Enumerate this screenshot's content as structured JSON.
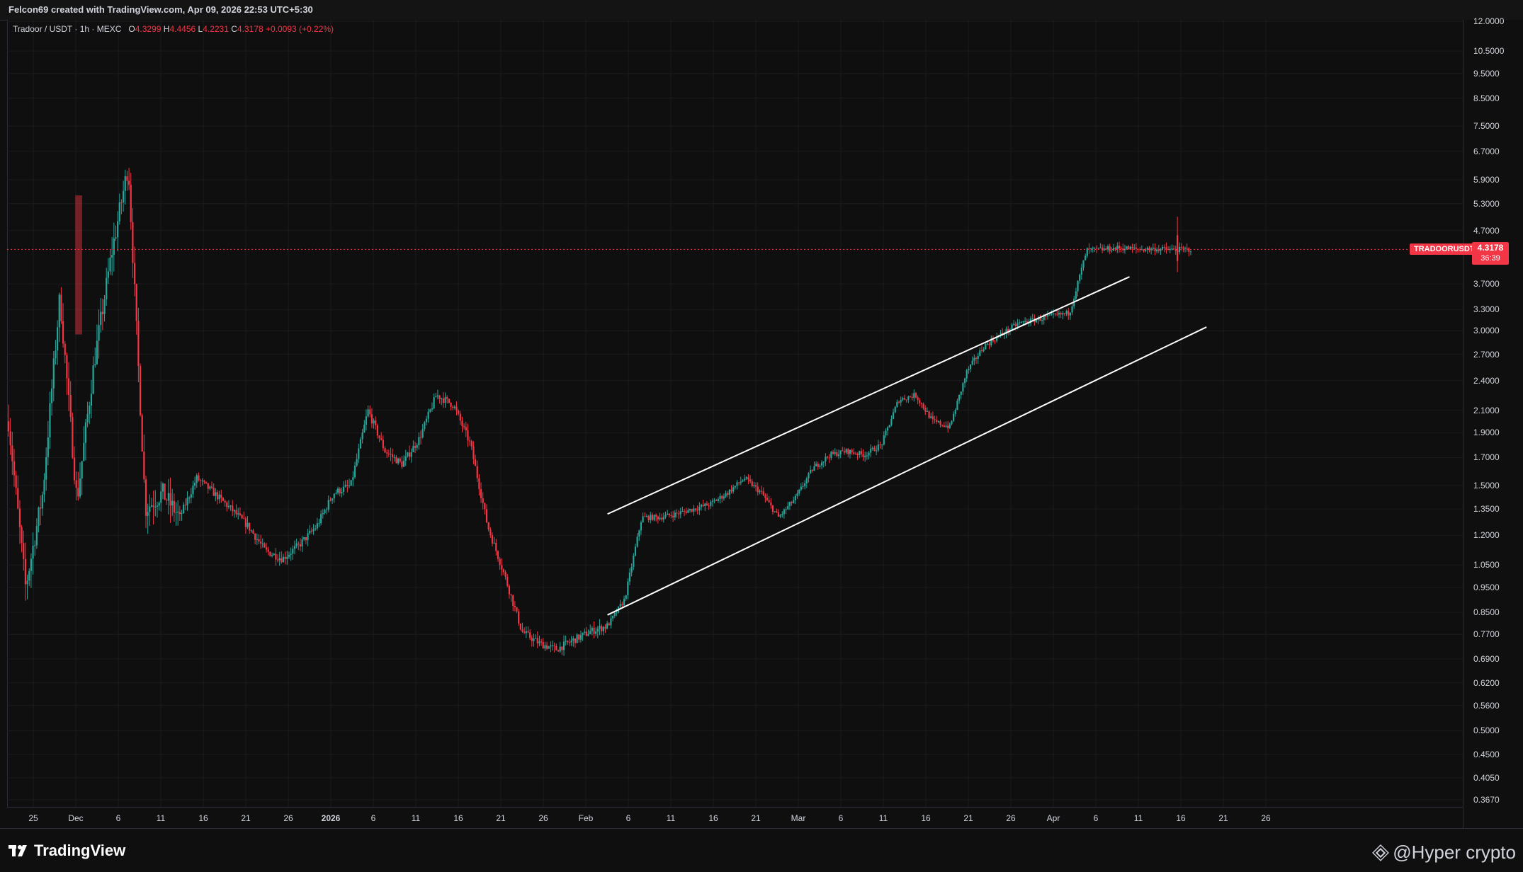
{
  "header": {
    "credit": "Felcon69 created with TradingView.com, Apr 09, 2026 22:53 UTC+5:30"
  },
  "legend": {
    "symbol": "Tradoor / USDT · 1h · MEXC",
    "open_label": "O",
    "open": "4.3299",
    "high_label": "H",
    "high": "4.4456",
    "low_label": "L",
    "low": "4.2231",
    "close_label": "C",
    "close": "4.3178",
    "change": "+0.0093 (+0.22%)"
  },
  "price_tag": {
    "symbol": "TRADOORUSDT",
    "price": "4.3178",
    "countdown": "36:39"
  },
  "footer": {
    "brand": "TradingView",
    "watermark": "@Hyper crypto"
  },
  "colors": {
    "up": "#26a69a",
    "down": "#f23645",
    "background": "#0f0f0f",
    "channel": "#ffffff"
  },
  "chart_data": {
    "type": "candlestick",
    "scale": "log",
    "price_ticks": [
      "12.0000",
      "10.5000",
      "9.5000",
      "8.5000",
      "7.5000",
      "6.7000",
      "5.9000",
      "5.3000",
      "4.7000",
      "3.7000",
      "3.3000",
      "3.0000",
      "2.7000",
      "2.4000",
      "2.1000",
      "1.9000",
      "1.7000",
      "1.5000",
      "1.3500",
      "1.2000",
      "1.0500",
      "0.9500",
      "0.8500",
      "0.7700",
      "0.6900",
      "0.6200",
      "0.5600",
      "0.5000",
      "0.4500",
      "0.4050",
      "0.3670"
    ],
    "price_tick_values": [
      12,
      10.5,
      9.5,
      8.5,
      7.5,
      6.7,
      5.9,
      5.3,
      4.7,
      3.7,
      3.3,
      3.0,
      2.7,
      2.4,
      2.1,
      1.9,
      1.7,
      1.5,
      1.35,
      1.2,
      1.05,
      0.95,
      0.85,
      0.77,
      0.69,
      0.62,
      0.56,
      0.5,
      0.45,
      0.405,
      0.367
    ],
    "time_ticks": [
      {
        "label": "25",
        "major": false
      },
      {
        "label": "Dec",
        "major": false
      },
      {
        "label": "6",
        "major": false
      },
      {
        "label": "11",
        "major": false
      },
      {
        "label": "16",
        "major": false
      },
      {
        "label": "21",
        "major": false
      },
      {
        "label": "26",
        "major": false
      },
      {
        "label": "2026",
        "major": true
      },
      {
        "label": "6",
        "major": false
      },
      {
        "label": "11",
        "major": false
      },
      {
        "label": "16",
        "major": false
      },
      {
        "label": "21",
        "major": false
      },
      {
        "label": "26",
        "major": false
      },
      {
        "label": "Feb",
        "major": false
      },
      {
        "label": "6",
        "major": false
      },
      {
        "label": "11",
        "major": false
      },
      {
        "label": "16",
        "major": false
      },
      {
        "label": "21",
        "major": false
      },
      {
        "label": "Mar",
        "major": false
      },
      {
        "label": "6",
        "major": false
      },
      {
        "label": "11",
        "major": false
      },
      {
        "label": "16",
        "major": false
      },
      {
        "label": "21",
        "major": false
      },
      {
        "label": "26",
        "major": false
      },
      {
        "label": "Apr",
        "major": false
      },
      {
        "label": "6",
        "major": false
      },
      {
        "label": "11",
        "major": false
      },
      {
        "label": "16",
        "major": false
      },
      {
        "label": "21",
        "major": false
      },
      {
        "label": "26",
        "major": false
      }
    ],
    "last_price": 4.3178,
    "path_days": [
      0,
      2,
      4,
      6,
      8,
      10,
      12,
      14,
      16,
      18,
      20,
      22,
      24,
      26,
      28,
      30,
      32,
      34,
      36,
      38,
      40,
      42,
      44,
      46,
      48,
      50,
      52,
      54,
      56,
      58,
      60,
      62,
      64,
      66,
      68,
      70,
      72,
      74,
      76,
      78,
      80,
      82,
      84,
      86,
      88,
      90,
      92,
      94,
      96,
      98,
      100,
      102,
      104,
      106,
      108,
      110,
      112,
      114,
      116,
      118,
      120,
      122,
      124,
      126,
      128,
      130,
      132,
      134,
      136,
      138
    ],
    "path_prices": [
      2.0,
      0.95,
      1.45,
      3.5,
      1.4,
      2.6,
      4.2,
      6.3,
      1.35,
      1.45,
      1.3,
      1.55,
      1.45,
      1.35,
      1.25,
      1.12,
      1.08,
      1.15,
      1.25,
      1.45,
      1.5,
      2.1,
      1.75,
      1.65,
      1.85,
      2.25,
      2.15,
      1.8,
      1.25,
      1.0,
      0.78,
      0.74,
      0.72,
      0.75,
      0.78,
      0.8,
      0.9,
      1.3,
      1.3,
      1.32,
      1.35,
      1.38,
      1.45,
      1.55,
      1.45,
      1.3,
      1.42,
      1.62,
      1.72,
      1.75,
      1.72,
      1.8,
      2.2,
      2.25,
      2.0,
      1.95,
      2.5,
      2.8,
      2.95,
      3.1,
      3.15,
      3.2,
      3.25,
      4.3,
      4.32,
      4.35,
      4.32,
      4.33,
      4.31,
      4.3178
    ],
    "channel_upper": {
      "start": {
        "day": 70,
        "price": 1.32
      },
      "end": {
        "day": 131,
        "price": 3.82
      }
    },
    "channel_lower": {
      "start": {
        "day": 70,
        "price": 0.84
      },
      "end": {
        "day": 140,
        "price": 3.05
      }
    },
    "resistance_box": {
      "day_start": 7.8,
      "day_end": 8.6,
      "price_top": 5.5,
      "price_bottom": 2.95
    }
  }
}
